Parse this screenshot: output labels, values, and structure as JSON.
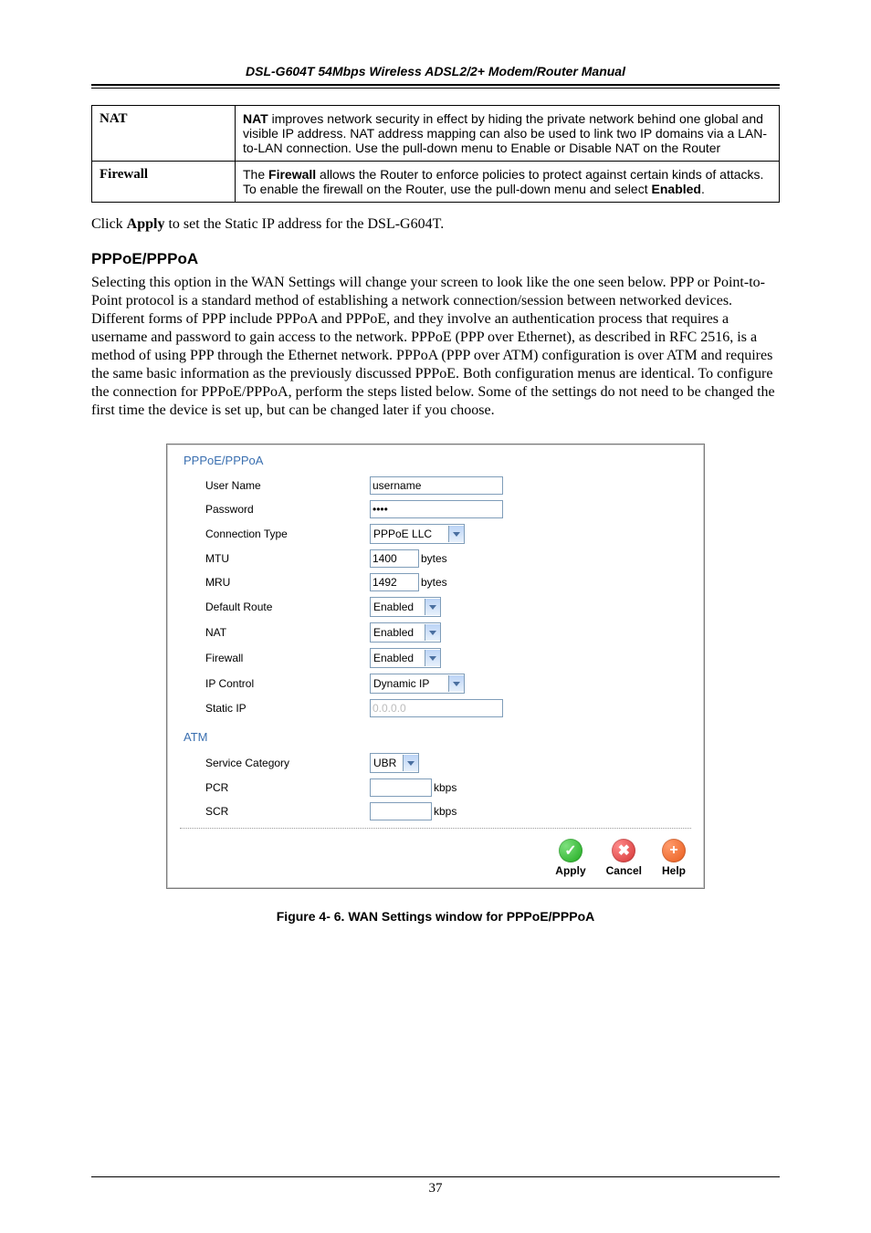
{
  "header": {
    "title": "DSL-G604T 54Mbps Wireless ADSL2/2+ Modem/Router Manual"
  },
  "defs": {
    "nat": {
      "term": "NAT",
      "leadBold": "NAT",
      "rest": " improves network security in effect by hiding the private network behind one global and visible IP address. NAT address mapping can also be used to link two IP domains via a LAN-to-LAN connection. Use the pull-down menu to Enable or Disable NAT on the Router"
    },
    "fw": {
      "term": "Firewall",
      "preBold1": "The ",
      "bold1": "Firewall",
      "mid": " allows the Router to enforce policies to protect against certain kinds of attacks.  To enable the firewall on the Router, use the pull-down menu and select ",
      "bold2": "Enabled",
      "tail": "."
    }
  },
  "para1": {
    "pre": "Click ",
    "bold": "Apply",
    "post": " to set the Static IP address for the DSL-G604T."
  },
  "sectionTitle": "PPPoE/PPPoA",
  "para2": "Selecting this option in the WAN Settings will change your screen to look like the one seen below. PPP or Point-to-Point protocol is a standard method of establishing a network connection/session between networked devices. Different forms of PPP include PPPoA and PPPoE, and they involve an authentication process that requires a username and password to gain access to the network. PPPoE (PPP over Ethernet), as described in RFC 2516, is a method of using PPP through the Ethernet network. PPPoA (PPP over ATM) configuration is over ATM and requires the same basic information as the previously discussed PPPoE. Both configuration menus are identical. To configure the connection for PPPoE/PPPoA, perform the steps listed below. Some of the settings do not need to be changed the first time the device is set up, but can be changed later if you choose.",
  "panel": {
    "title1": "PPPoE/PPPoA",
    "rows": {
      "userName": {
        "label": "User Name",
        "value": "username"
      },
      "password": {
        "label": "Password",
        "value": "••••"
      },
      "connType": {
        "label": "Connection Type",
        "value": "PPPoE LLC"
      },
      "mtu": {
        "label": "MTU",
        "value": "1400",
        "unit": "bytes"
      },
      "mru": {
        "label": "MRU",
        "value": "1492",
        "unit": "bytes"
      },
      "defaultRoute": {
        "label": "Default Route",
        "value": "Enabled"
      },
      "nat": {
        "label": "NAT",
        "value": "Enabled"
      },
      "firewall": {
        "label": "Firewall",
        "value": "Enabled"
      },
      "ipControl": {
        "label": "IP Control",
        "value": "Dynamic IP"
      },
      "staticIp": {
        "label": "Static IP",
        "value": "0.0.0.0"
      }
    },
    "title2": "ATM",
    "atmRows": {
      "serviceCat": {
        "label": "Service Category",
        "value": "UBR"
      },
      "pcr": {
        "label": "PCR",
        "value": "",
        "unit": "kbps"
      },
      "scr": {
        "label": "SCR",
        "value": "",
        "unit": "kbps"
      }
    },
    "actions": {
      "apply": "Apply",
      "cancel": "Cancel",
      "help": "Help"
    }
  },
  "caption": "Figure 4- 6. WAN Settings window for PPPoE/PPPoA",
  "pageNumber": "37"
}
